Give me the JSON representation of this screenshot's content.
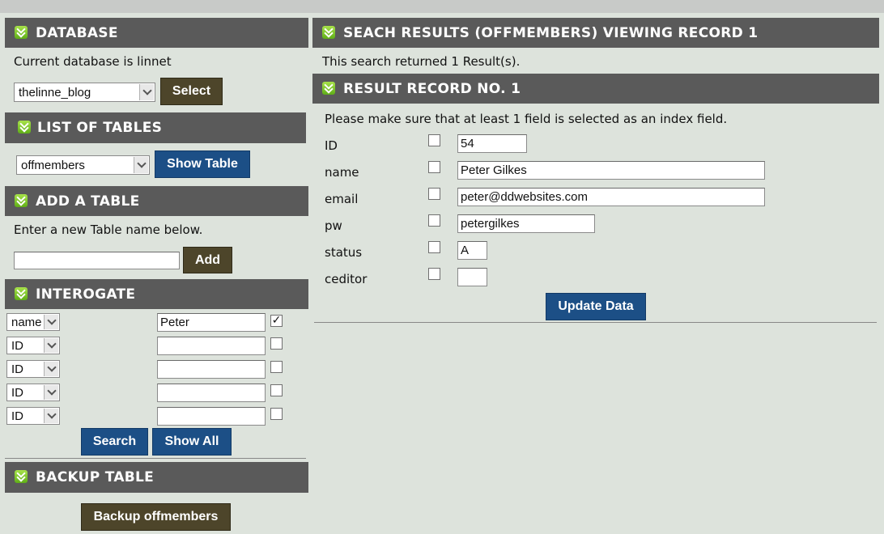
{
  "left": {
    "database": {
      "title": "DATABASE",
      "current_text": "Current database is linnet",
      "selected_db": "thelinne_blog",
      "select_button": "Select"
    },
    "tables": {
      "title": "LIST OF TABLES",
      "selected_table": "offmembers",
      "show_button": "Show Table"
    },
    "add": {
      "title": "ADD A TABLE",
      "instruction": "Enter a new Table name below.",
      "input_value": "",
      "add_button": "Add"
    },
    "interogate": {
      "title": "INTEROGATE",
      "rows": [
        {
          "field": "name",
          "value": "Peter",
          "checked": true
        },
        {
          "field": "ID",
          "value": "",
          "checked": false
        },
        {
          "field": "ID",
          "value": "",
          "checked": false
        },
        {
          "field": "ID",
          "value": "",
          "checked": false
        },
        {
          "field": "ID",
          "value": "",
          "checked": false
        }
      ],
      "search_button": "Search",
      "show_all_button": "Show All"
    },
    "backup": {
      "title": "BACKUP TABLE",
      "button": "Backup offmembers"
    }
  },
  "right": {
    "search_header": "SEACH RESULTS (OFFMEMBERS) VIEWING RECORD 1",
    "result_count": "This search returned 1 Result(s).",
    "record_header": "RESULT RECORD NO. 1",
    "index_note": "Please make sure that at least 1 field is selected as an index field.",
    "fields": [
      {
        "label": "ID",
        "value": "54",
        "checked": false
      },
      {
        "label": "name",
        "value": "Peter Gilkes",
        "checked": false
      },
      {
        "label": "email",
        "value": "peter@ddwebsites.com",
        "checked": false
      },
      {
        "label": "pw",
        "value": "petergilkes",
        "checked": false
      },
      {
        "label": "status",
        "value": "A",
        "checked": false
      },
      {
        "label": "ceditor",
        "value": "",
        "checked": false
      }
    ],
    "update_button": "Update Data"
  },
  "colors": {
    "header_bg": "#5a5a5a",
    "page_bg": "#dde3dc",
    "dark_button": "#4d452a",
    "blue_button": "#1c4f86",
    "icon_green": "#6fbe1f"
  }
}
